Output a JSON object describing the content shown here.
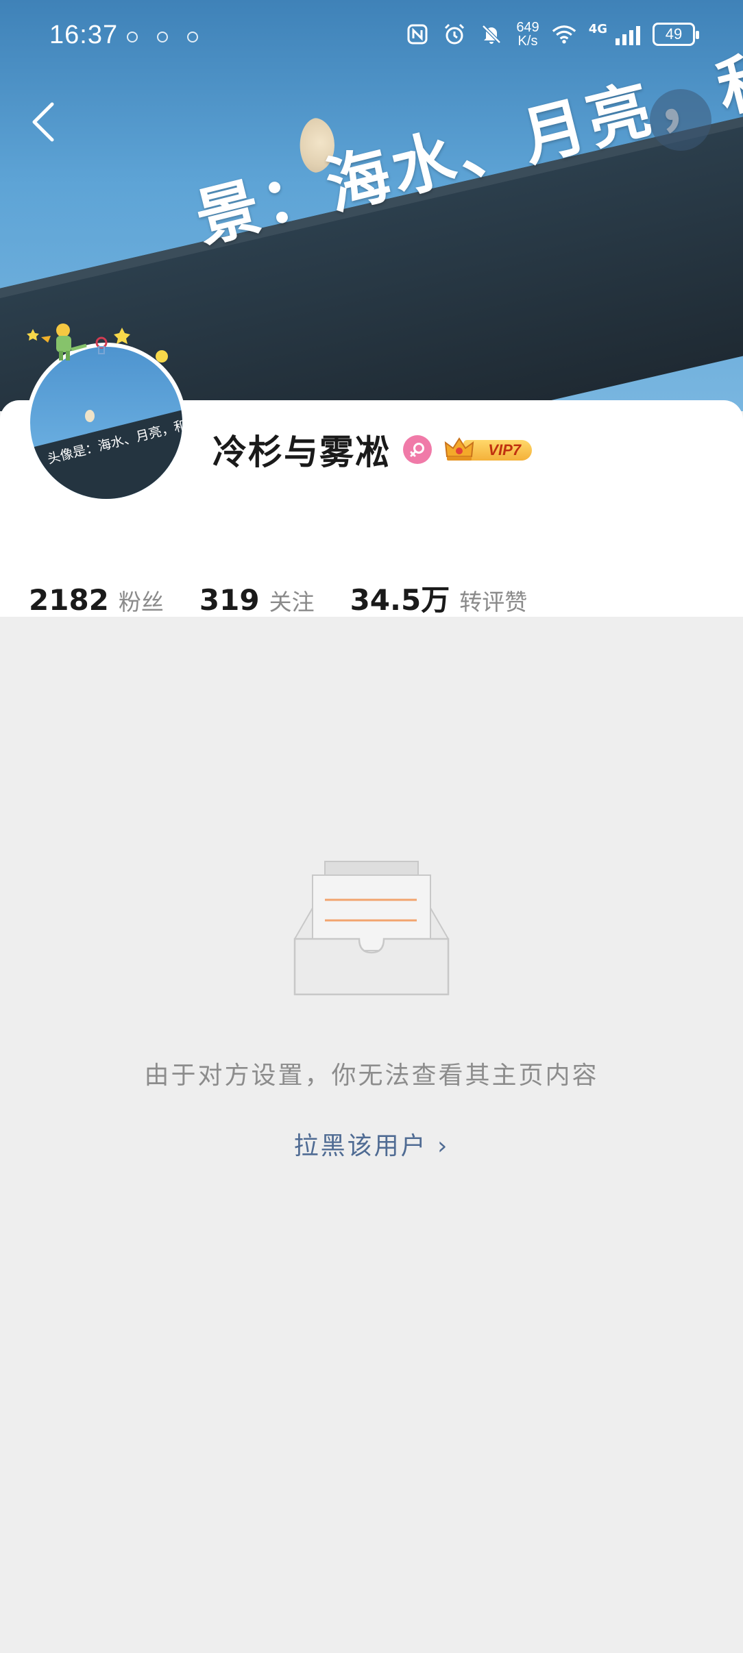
{
  "status_bar": {
    "time": "16:37",
    "net_speed_value": "649",
    "net_speed_unit": "K/s",
    "network_type": "4G",
    "battery": "49"
  },
  "banner": {
    "text": "景：海水、月亮，和一些心碎"
  },
  "avatar": {
    "text": "头像是：海水、月亮，和一些心碎"
  },
  "profile": {
    "username": "冷杉与雾凇",
    "vip_label": "VIP7",
    "stats": [
      {
        "value": "2182",
        "label": "粉丝"
      },
      {
        "value": "319",
        "label": "关注"
      },
      {
        "value": "34.5万",
        "label": "转评赞"
      }
    ]
  },
  "empty_state": {
    "message": "由于对方设置，你无法查看其主页内容",
    "block_link": "拉黑该用户 ›"
  },
  "colors": {
    "page_background": "#eeeeee",
    "link_blue": "#4f6b93",
    "gender_pink": "#f07aa8",
    "vip_gold": "#f4b13a"
  }
}
